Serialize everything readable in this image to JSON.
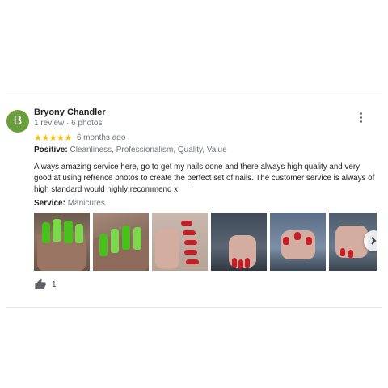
{
  "review": {
    "avatar_letter": "B",
    "author": "Bryony Chandler",
    "meta": "1 review · 6 photos",
    "stars": "★★★★★",
    "time": "6 months ago",
    "positive_label": "Positive:",
    "positive_values": "Cleanliness, Professionalism, Quality, Value",
    "text": "Always amazing service here, go to get my nails done and there always high quality and very good at using refrence photos to create the perfect set of nails. The customer service is always of high standard would highly recommend x",
    "service_label": "Service:",
    "service_value": "Manicures",
    "likes": "1"
  },
  "colors": {
    "avatar": "#689f38",
    "star": "#fbbc04",
    "muted": "#70757a"
  },
  "icons": [
    "more-vert-icon",
    "thumb-up-icon",
    "chevron-right-icon"
  ]
}
